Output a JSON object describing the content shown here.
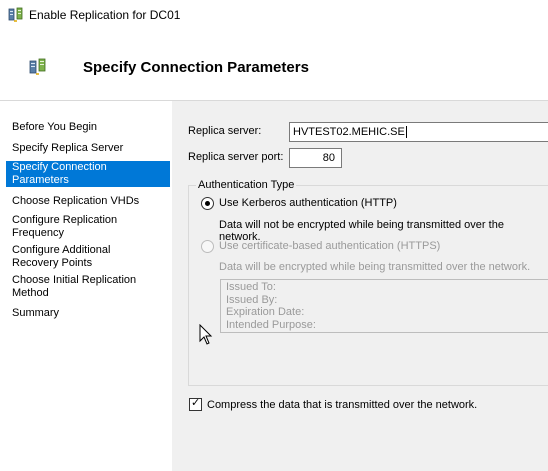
{
  "window": {
    "title": "Enable Replication for DC01"
  },
  "header": {
    "title": "Specify Connection Parameters"
  },
  "nav": {
    "items": [
      {
        "label": "Before You Begin"
      },
      {
        "label": "Specify Replica Server"
      },
      {
        "label": "Specify Connection Parameters",
        "line1": "Specify Connection",
        "line2": "Parameters"
      },
      {
        "label": "Choose Replication VHDs"
      },
      {
        "label": "Configure Replication Frequency",
        "line1": "Configure Replication",
        "line2": "Frequency"
      },
      {
        "label": "Configure Additional Recovery Points",
        "line1": "Configure Additional",
        "line2": "Recovery Points"
      },
      {
        "label": "Choose Initial Replication Method",
        "line1": "Choose Initial Replication",
        "line2": "Method"
      },
      {
        "label": "Summary"
      }
    ],
    "selected_color": "#0078d7"
  },
  "form": {
    "replica_server_label": "Replica server:",
    "replica_server_value": "HVTEST02.MEHIC.SE",
    "replica_port_label": "Replica server port:",
    "replica_port_value": "80"
  },
  "auth": {
    "legend": "Authentication Type",
    "kerberos_label": "Use Kerberos authentication (HTTP)",
    "kerberos_selected": true,
    "kerberos_note": "Data will not be encrypted while being transmitted over the network.",
    "cert_label": "Use certificate-based authentication (HTTPS)",
    "cert_note": "Data will be encrypted while being transmitted over the network.",
    "cert_fields": {
      "issued_to": "Issued To:",
      "issued_by": "Issued By:",
      "expiration": "Expiration Date:",
      "purpose": "Intended Purpose:"
    }
  },
  "compress": {
    "label": "Compress the data that is transmitted over the network.",
    "checked": true
  },
  "icons": {
    "window_icon": "server-replication-icon",
    "header_icon": "server-replication-icon",
    "cursor": "mouse-pointer-icon"
  }
}
